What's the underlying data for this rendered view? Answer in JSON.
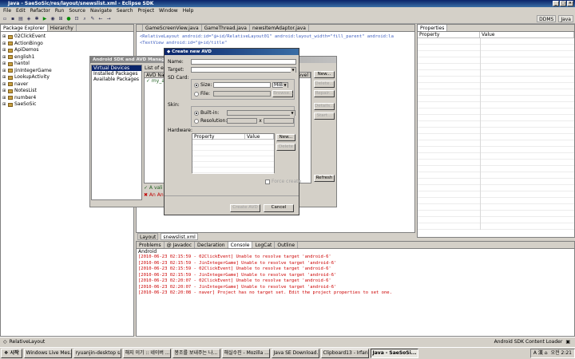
{
  "window": {
    "title": "Java - SaeSoSic/res/layout/snewslist.xml - Eclipse SDK"
  },
  "menu": [
    "File",
    "Edit",
    "Refactor",
    "Run",
    "Source",
    "Navigate",
    "Search",
    "Project",
    "Window",
    "Help"
  ],
  "perspectives": [
    "DDMS",
    "Java"
  ],
  "package_explorer": {
    "tabs": [
      "Package Explorer",
      "Hierarchy"
    ],
    "projects": [
      "02ClickEvent",
      "ActionBingo",
      "ApiDemos",
      "english1",
      "hantol",
      "JinIntegerGame",
      "LookupActivity",
      "naver",
      "NotesList",
      "number4",
      "SaeSoSic"
    ]
  },
  "editor": {
    "tabs": [
      "GameScreenView.java",
      "GameThread.java",
      "newsItemAdaptor.java"
    ],
    "code": [
      "<RelativeLayout android:id=\"@+id/RelativeLayout01\" android:layout_width=\"fill_parent\" android:la",
      "<TextView android:id=\"@+id/title\""
    ]
  },
  "layout_tabs": [
    "Layout",
    "snewslist.xml"
  ],
  "properties": {
    "tab": "Properties",
    "columns": [
      "Property",
      "Value"
    ]
  },
  "avd_manager": {
    "title": "Android SDK and AVD Manager",
    "nav": [
      "Virtual Devices",
      "Installed Packages",
      "Available Packages"
    ],
    "list_label": "List of ex",
    "columns": [
      "AVD Na",
      "Level"
    ],
    "rows": [
      "✓ my_a"
    ],
    "buttons": [
      "New...",
      "Delete...",
      "Repair...",
      "Details...",
      "Start..."
    ],
    "refresh": "Refresh",
    "legend": [
      "✓ A vali",
      "✖ An An"
    ]
  },
  "new_avd": {
    "title": "Create new AVD",
    "name_label": "Name:",
    "target_label": "Target:",
    "sdcard_label": "SD Card:",
    "size_label": "Size:",
    "size_unit": "MiB",
    "file_label": "File:",
    "browse": "Browse...",
    "skin_label": "Skin:",
    "builtin_label": "Built-in:",
    "resolution_label": "Resolution:",
    "x_label": "x",
    "hardware_label": "Hardware:",
    "hw_columns": [
      "Property",
      "Value"
    ],
    "hw_new": "New...",
    "hw_delete": "Delete",
    "force_create": "Force create",
    "create_button": "Create AVD",
    "cancel_button": "Cancel"
  },
  "console": {
    "tabs": [
      "Problems",
      "@ Javadoc",
      "Declaration",
      "Console",
      "LogCat",
      "Outline"
    ],
    "active_tab": "Console",
    "title": "Android",
    "lines": [
      "[2010-06-23 02:15:59 - 02ClickEvent] Unable to resolve target 'android-6'",
      "[2010-06-23 02:15:59 - JinIntegerGame] Unable to resolve target 'android-6'",
      "[2010-06-23 02:15:59 - 02ClickEvent] Unable to resolve target 'android-6'",
      "[2010-06-23 02:15:59 - JinIntegerGame] Unable to resolve target 'android-6'",
      "[2010-06-23 02:20:07 - 02ClickEvent] Unable to resolve target 'android-6'",
      "[2010-06-23 02:20:07 - JinIntegerGame] Unable to resolve target 'android-6'",
      "[2010-06-23 02:20:08 - naver] Project has no target set. Edit the project properties to set one."
    ]
  },
  "status": {
    "left": "RelativeLayout",
    "right": "Android SDK Content Loader"
  },
  "taskbar": {
    "start": "❖ 시작",
    "tasks": [
      "Windows Live Mes...",
      "ryuanjin-desktop s...",
      "해지 이기 :: 네이버 ...",
      "봉조를 보내주는 나...",
      "해실수진 - Mozilla ...",
      "Java SE Download...",
      "Clipboard13 - Irfan...",
      "Java - SaeSoSi..."
    ],
    "clock": "오전 2:21",
    "tray_text": "A 漢 ⌂"
  }
}
